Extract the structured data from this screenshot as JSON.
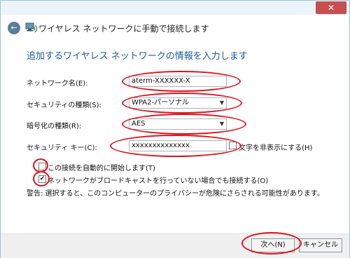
{
  "window": {
    "close_label": "✕"
  },
  "header": {
    "back_glyph": "←",
    "title": "ワイヤレス ネットワークに手動で接続します"
  },
  "main": {
    "subtitle": "追加するワイヤレス ネットワークの情報を入力します",
    "network_name": {
      "label": "ネットワーク名(E):",
      "value": "aterm-XXXXXX-X"
    },
    "security_type": {
      "label": "セキュリティの種類(S):",
      "value": "WPA2-パーソナル"
    },
    "encryption_type": {
      "label": "暗号化の種類(R):",
      "value": "AES"
    },
    "security_key": {
      "label": "セキュリティ キー(C):",
      "value": "xxxxxxxxxxxxxx"
    },
    "hide_chars": {
      "label": "文字を非表示にする(H)",
      "checked": false
    },
    "auto_connect": {
      "label": "この接続を自動的に開始します(T)",
      "checked": false
    },
    "connect_hidden": {
      "label": "ネットワークがブロードキャストを行っていない場合でも接続する(O)",
      "checked": true
    },
    "warning": "警告: 選択すると、このコンピューターのプライバシーが危険にさらされる可能性があります。"
  },
  "footer": {
    "next_label": "次へ(N)",
    "cancel_label": "キャンセル"
  },
  "colors": {
    "highlight_ring": "#e0121c",
    "subtitle": "#1e5aa0",
    "close": "#c74f4f"
  }
}
